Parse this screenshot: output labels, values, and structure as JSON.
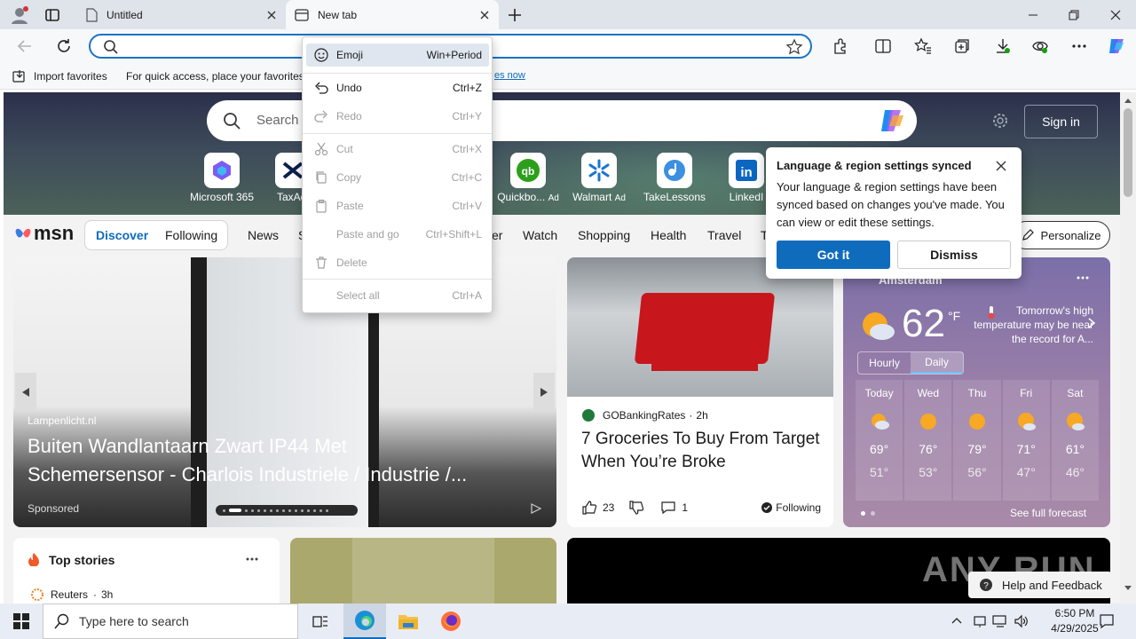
{
  "tabs": [
    {
      "title": "Untitled"
    },
    {
      "title": "New tab"
    }
  ],
  "favorites": {
    "import_label": "Import favorites",
    "quick_access": "For quick access, place your favorites",
    "manage_link": "es now"
  },
  "context_menu": {
    "items": [
      {
        "label": "Emoji",
        "shortcut": "Win+Period",
        "enabled": true
      },
      {
        "label": "Undo",
        "shortcut": "Ctrl+Z",
        "enabled": true
      },
      {
        "label": "Redo",
        "shortcut": "Ctrl+Y",
        "enabled": false
      },
      {
        "label": "Cut",
        "shortcut": "Ctrl+X",
        "enabled": false
      },
      {
        "label": "Copy",
        "shortcut": "Ctrl+C",
        "enabled": false
      },
      {
        "label": "Paste",
        "shortcut": "Ctrl+V",
        "enabled": false
      },
      {
        "label": "Paste and go",
        "shortcut": "Ctrl+Shift+L",
        "enabled": false
      },
      {
        "label": "Delete",
        "shortcut": "",
        "enabled": false
      },
      {
        "label": "Select all",
        "shortcut": "Ctrl+A",
        "enabled": false
      }
    ]
  },
  "newtab": {
    "search_placeholder": "Search",
    "signin": "Sign in",
    "quicklinks": [
      {
        "label": "Microsoft 365",
        "ad": false
      },
      {
        "label": "TaxAct",
        "ad": false
      },
      {
        "label": "Quickbo...",
        "ad": true
      },
      {
        "label": "Walmart",
        "ad": true
      },
      {
        "label": "TakeLessons",
        "ad": false
      },
      {
        "label": "LinkedI",
        "ad": false
      }
    ],
    "ad_label": "Ad"
  },
  "msn": {
    "logo": "msn",
    "nav": {
      "discover": "Discover",
      "following": "Following",
      "items": [
        "News",
        "S",
        "er",
        "Watch",
        "Shopping",
        "Health",
        "Travel",
        "T"
      ],
      "personalize": "Personalize"
    }
  },
  "hero_card": {
    "source": "Lampenlicht.nl",
    "title_line1": "Buiten Wandlantaarn Zwart IP44 Met",
    "title_line2": "Schemersensor - Charlois Industriele / Industrie /...",
    "sponsored": "Sponsored"
  },
  "news_card": {
    "source": "GOBankingRates",
    "time": "2h",
    "title": "7 Groceries To Buy From Target When You’re Broke",
    "likes": "23",
    "comments": "1",
    "following": "Following"
  },
  "weather": {
    "location": "Amsterdam",
    "temp": "62",
    "unit": "°F",
    "alert": "Tomorrow's high temperature may be near the record for A...",
    "tabs": [
      "Hourly",
      "Daily"
    ],
    "days": [
      {
        "day": "Today",
        "hi": "69°",
        "lo": "51°",
        "icon": "partly-sunny-icon"
      },
      {
        "day": "Wed",
        "hi": "76°",
        "lo": "53°",
        "icon": "sunny-icon"
      },
      {
        "day": "Thu",
        "hi": "79°",
        "lo": "56°",
        "icon": "sunny-icon"
      },
      {
        "day": "Fri",
        "hi": "71°",
        "lo": "47°",
        "icon": "mostly-sunny-icon"
      },
      {
        "day": "Sat",
        "hi": "61°",
        "lo": "46°",
        "icon": "mostly-sunny-icon"
      }
    ],
    "see_full": "See full forecast"
  },
  "popup": {
    "title": "Language & region settings synced",
    "body": "Your language & region settings have been synced based on changes you've made. You can view or edit these settings.",
    "primary": "Got it",
    "secondary": "Dismiss"
  },
  "top_stories": {
    "title": "Top stories",
    "source": "Reuters",
    "time": "3h"
  },
  "feedback": "Help and Feedback",
  "watermark": "ANY RUN",
  "taskbar": {
    "search_placeholder": "Type here to search",
    "time": "6:50 PM",
    "date": "4/29/2025"
  },
  "colors": {
    "accent": "#0f6cbd",
    "address_border": "#1a73c8"
  }
}
